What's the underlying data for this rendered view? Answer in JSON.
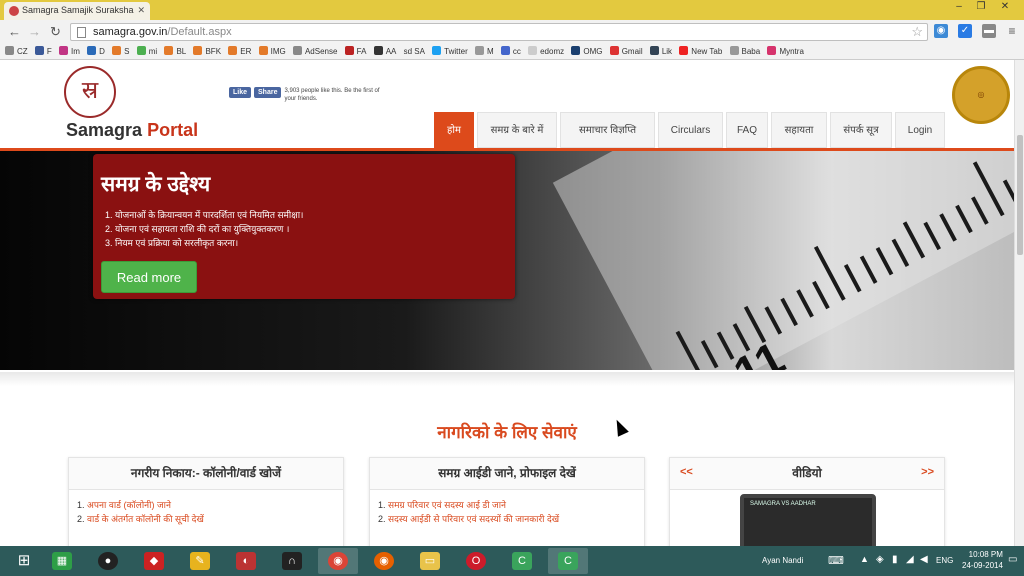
{
  "browser": {
    "tab_title": "Samagra Samajik Suraksha",
    "url_host": "samagra.gov.in",
    "url_path": "/Default.aspx",
    "window_controls": [
      "–",
      "❐",
      "✕"
    ],
    "bookmarks": [
      "CZ",
      "F",
      "Im",
      "D",
      "S",
      "mi",
      "BL",
      "BFK",
      "ER",
      "IMG",
      "AdSense",
      "FA",
      "AA",
      "sd SA",
      "Twitter",
      "M",
      "cc",
      "edomz",
      "OMG",
      "Gmail",
      "Lik",
      "New Tab",
      "Baba",
      "Myntra"
    ]
  },
  "header": {
    "logo_glyph": "स्र",
    "portal_word1": "Samagra",
    "portal_word2": "Portal",
    "fb_like": "Like",
    "fb_share": "Share",
    "fb_text": "3,903 people like this. Be the first of your friends."
  },
  "nav": {
    "items": [
      "होम",
      "समग्र के बारे में",
      "समाचार विज्ञप्ति",
      "Circulars",
      "FAQ",
      "सहायता",
      "संपर्क सूत्र",
      "Login"
    ]
  },
  "hero": {
    "title": "समग्र के उद्देश्य",
    "points": [
      "1.  योजनाओं के क्रियान्वयन में पारदर्शिता एवं नियमित समीक्षा।",
      "2.  योजना एवं सहायता राशि की दरों का युक्तियुक्तकरण ।",
      "3.  नियम एवं प्रक्रिया को सरलीकृत करना।"
    ],
    "read_more": "Read more"
  },
  "services": {
    "title": "नागरिको के लिए सेवाएं",
    "cards": [
      {
        "title": "नगरीय निकाय:- कॉलोनी/वार्ड खोजें",
        "items": [
          [
            "1.",
            "अपना वार्ड (कॉलोनी) जाने"
          ],
          [
            "2.",
            "वार्ड के अंतर्गत कॉलोनी की सूची देखें"
          ]
        ]
      },
      {
        "title": "समग्र आईडी जाने, प्रोफाइल देखें",
        "items": [
          [
            "1.",
            "समग्र परिवार एवं सदस्य आई डी जाने"
          ],
          [
            "2.",
            "सदस्य आईडी से परिवार एवं सदस्यों की जानकारी देखें"
          ]
        ]
      },
      {
        "title": "वीडियो",
        "prev": "<<",
        "next": ">>",
        "thumb_text": "SAMAGRA VS AADHAR"
      }
    ]
  },
  "taskbar": {
    "user": "Ayan Nandi",
    "lang": "ENG",
    "time": "10:08 PM",
    "date": "24-09-2014"
  }
}
